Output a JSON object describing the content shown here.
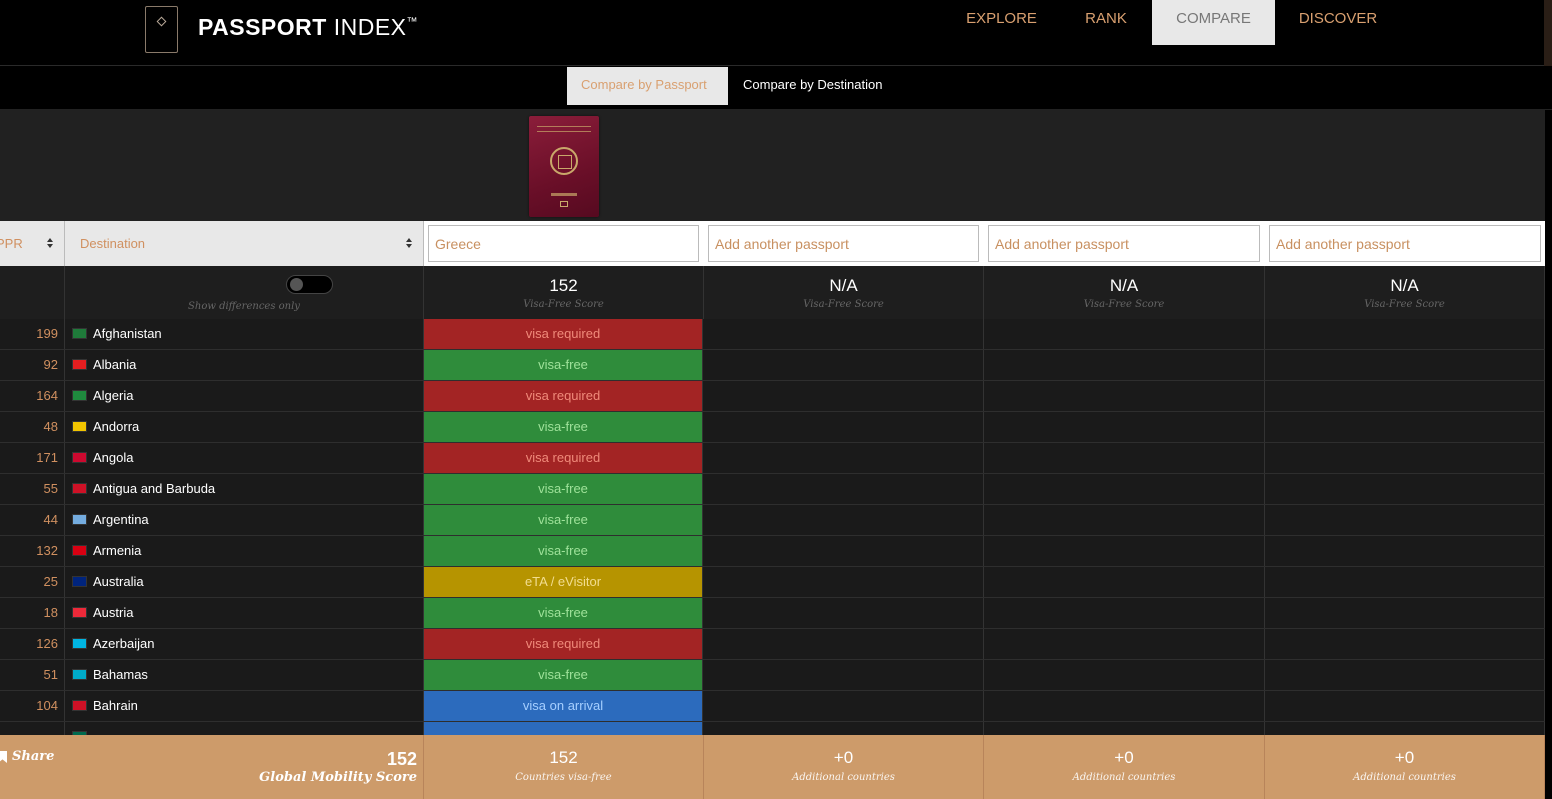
{
  "header": {
    "brand_bold": "PASSPORT",
    "brand_light": " INDEX",
    "brand_tm": "™",
    "nav": [
      {
        "label": "EXPLORE"
      },
      {
        "label": "RANK"
      },
      {
        "label": "COMPARE"
      },
      {
        "label": "DISCOVER"
      }
    ]
  },
  "subnav": {
    "by_passport": "Compare by Passport",
    "by_destination": "Compare by Destination"
  },
  "table_header": {
    "rank_label": "PPR",
    "destination_label": "Destination",
    "passport_1_value": "Greece",
    "add_placeholder": "Add another passport"
  },
  "scores": {
    "show_differences": "Show differences only",
    "passport_1": "152",
    "passport_2": "N/A",
    "passport_3": "N/A",
    "passport_4": "N/A",
    "label": "Visa-Free Score"
  },
  "rows": [
    {
      "rank": "199",
      "country": "Afghanistan",
      "status": "visa required",
      "kind": "vr",
      "flag": "#1f7a3a"
    },
    {
      "rank": "92",
      "country": "Albania",
      "status": "visa-free",
      "kind": "vf",
      "flag": "#e41e20"
    },
    {
      "rank": "164",
      "country": "Algeria",
      "status": "visa required",
      "kind": "vr",
      "flag": "#1f8a3e"
    },
    {
      "rank": "48",
      "country": "Andorra",
      "status": "visa-free",
      "kind": "vf",
      "flag": "#f2c500"
    },
    {
      "rank": "171",
      "country": "Angola",
      "status": "visa required",
      "kind": "vr",
      "flag": "#cc092f"
    },
    {
      "rank": "55",
      "country": "Antigua and Barbuda",
      "status": "visa-free",
      "kind": "vf",
      "flag": "#ce1126"
    },
    {
      "rank": "44",
      "country": "Argentina",
      "status": "visa-free",
      "kind": "vf",
      "flag": "#74acdf"
    },
    {
      "rank": "132",
      "country": "Armenia",
      "status": "visa-free",
      "kind": "vf",
      "flag": "#d90012"
    },
    {
      "rank": "25",
      "country": "Australia",
      "status": "eTA / eVisitor",
      "kind": "eta",
      "flag": "#00247d"
    },
    {
      "rank": "18",
      "country": "Austria",
      "status": "visa-free",
      "kind": "vf",
      "flag": "#ed2939"
    },
    {
      "rank": "126",
      "country": "Azerbaijan",
      "status": "visa required",
      "kind": "vr",
      "flag": "#00b5e2"
    },
    {
      "rank": "51",
      "country": "Bahamas",
      "status": "visa-free",
      "kind": "vf",
      "flag": "#00abc9"
    },
    {
      "rank": "104",
      "country": "Bahrain",
      "status": "visa on arrival",
      "kind": "voa",
      "flag": "#ce1126"
    },
    {
      "rank": "",
      "country": "",
      "status": "",
      "kind": "voa",
      "flag": "#006a4e"
    }
  ],
  "footer": {
    "share": "Share",
    "global_score": "152",
    "global_label": "Global Mobility Score",
    "p1_num": "152",
    "p1_label": "Countries visa-free",
    "p2_num": "+0",
    "p3_num": "+0",
    "p4_num": "+0",
    "additional_label": "Additional countries"
  },
  "colors": {
    "accent": "#d09060",
    "visa_required": "#a32424",
    "visa_free": "#2f8c3b",
    "eta": "#b69400",
    "visa_on_arrival": "#2c6bbd",
    "footer": "#cd9b6a"
  }
}
